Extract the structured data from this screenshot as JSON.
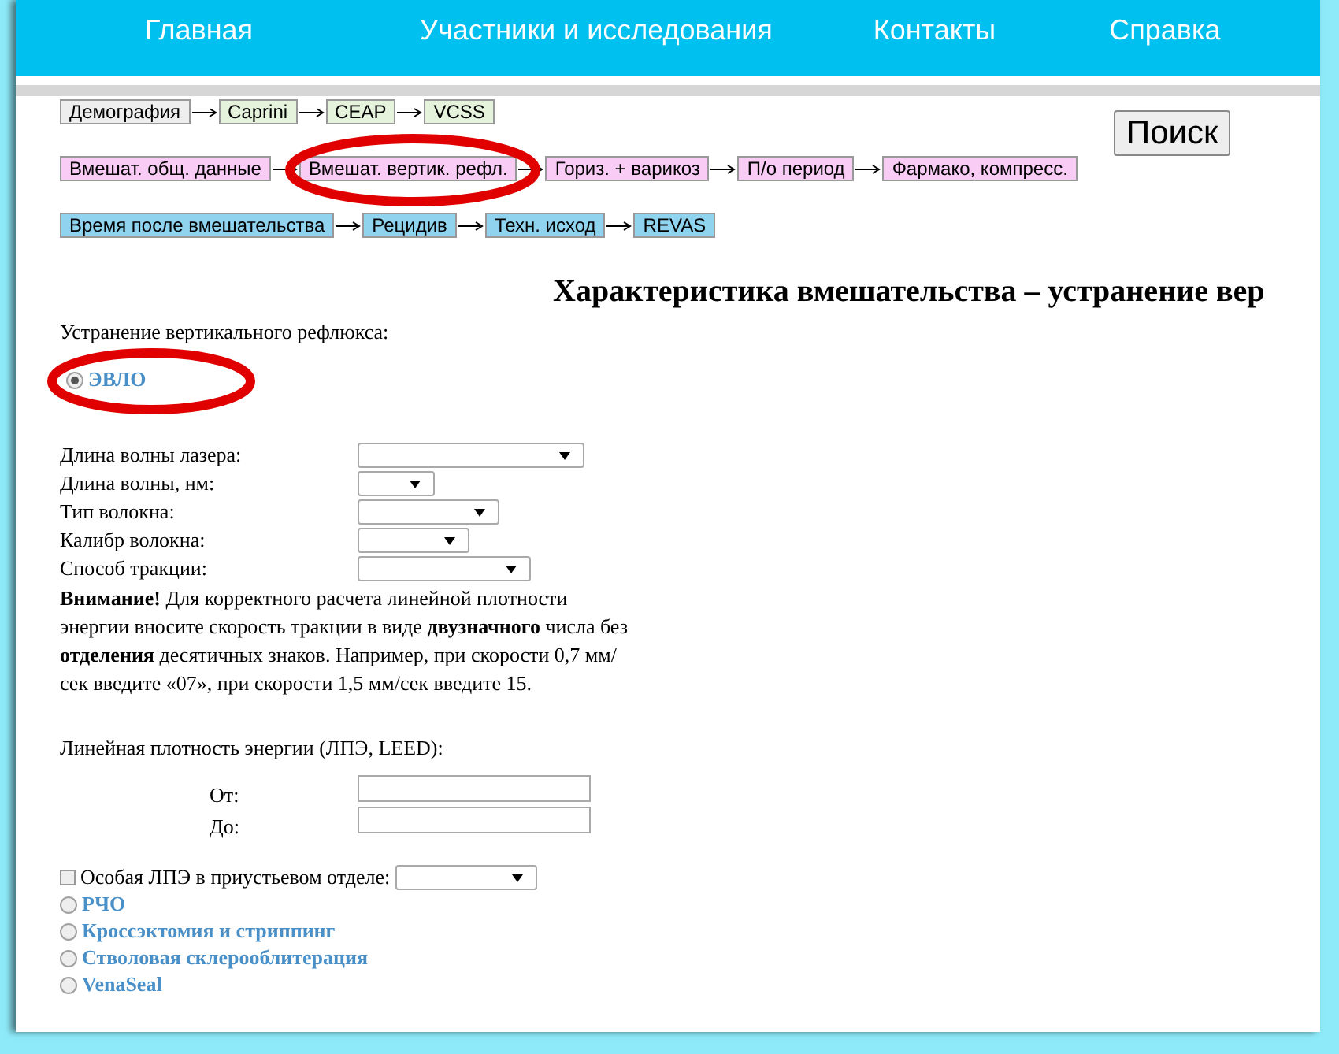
{
  "nav": [
    {
      "label": "Главная"
    },
    {
      "label": "Участники и исследования"
    },
    {
      "label": "Контакты"
    },
    {
      "label": "Справка"
    }
  ],
  "steps": [
    [
      {
        "label": "Демография",
        "color": "#eeeeee"
      },
      {
        "label": "Caprini",
        "color": "#e5f3dc"
      },
      {
        "label": "CEAP",
        "color": "#e5f3dc"
      },
      {
        "label": "VCSS",
        "color": "#e5f3dc"
      }
    ],
    [
      {
        "label": "Вмешат. общ. данные",
        "color": "#f9ccf5"
      },
      {
        "label": "Вмешат. вертик. рефл.",
        "color": "#f9ccf5"
      },
      {
        "label": "Гориз. + варикоз",
        "color": "#f9ccf5"
      },
      {
        "label": "П/о период",
        "color": "#f9ccf5"
      },
      {
        "label": "Фармако, компресс.",
        "color": "#f9ccf5"
      }
    ],
    [
      {
        "label": "Время после вмешательства",
        "color": "#8fd3ef"
      },
      {
        "label": "Рецидив",
        "color": "#8fd3ef"
      },
      {
        "label": "Техн. исход",
        "color": "#8fd3ef"
      },
      {
        "label": "REVAS",
        "color": "#8fd3ef"
      }
    ]
  ],
  "search_button": "Поиск",
  "heading": "Характеристика вмешательства – устранение вер",
  "group_label": "Устранение вертикального рефлюкса:",
  "first_option": {
    "label": "ЭВЛО",
    "selected": true
  },
  "fields": [
    {
      "label": "Длина волны лазера:",
      "kind": "select"
    },
    {
      "label": "Длина волны, нм:",
      "kind": "select"
    },
    {
      "label": "Тип волокна:",
      "kind": "select"
    },
    {
      "label": "Калибр волокна:",
      "kind": "select"
    },
    {
      "label": "Способ тракции:",
      "kind": "select"
    }
  ],
  "notice": "**Внимание!** Для корректного расчета линейной плотности энергии вносите скорость тракции в виде **двузначного** числа без **отделения** десятичных знаков. Например, при скорости 0,7 мм/сек введите «07», при скорости 1,5 мм/сек введите 15.",
  "leed_label": "Линейная плотность энергии (ЛПЭ, LEED):",
  "range": [
    {
      "label": "От:"
    },
    {
      "label": "До:"
    }
  ],
  "special": {
    "label": "Особая ЛПЭ в приустьевом отделе:",
    "checked": false
  },
  "options": [
    {
      "label": "РЧО",
      "selected": false
    },
    {
      "label": "Кроссэктомия и стриппинг",
      "selected": false
    },
    {
      "label": "Стволовая склерооблитерация",
      "selected": false
    },
    {
      "label": "VenaSeal",
      "selected": false
    }
  ]
}
